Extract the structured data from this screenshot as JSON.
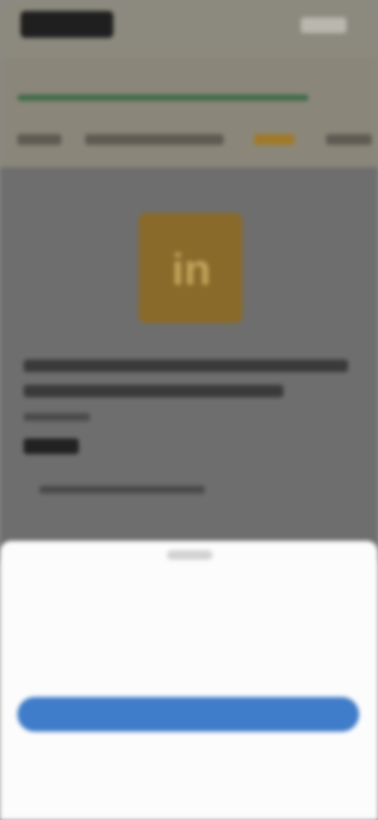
{
  "header": {
    "logo_text": "",
    "right_label": ""
  },
  "breadcrumb": {
    "items": [
      "",
      "",
      "",
      ""
    ]
  },
  "product": {
    "image_mark": "in",
    "title_line_1": "",
    "title_line_2": "",
    "meta": "",
    "price": "",
    "note": ""
  },
  "consent": {
    "handle_label": "",
    "title": "",
    "body": "",
    "options_link": "",
    "accept_button": "",
    "reject_link": "",
    "privacy_link": "",
    "accent_color": "#3f7cc9"
  },
  "icons": {
    "product_icon": "product-image-icon"
  }
}
